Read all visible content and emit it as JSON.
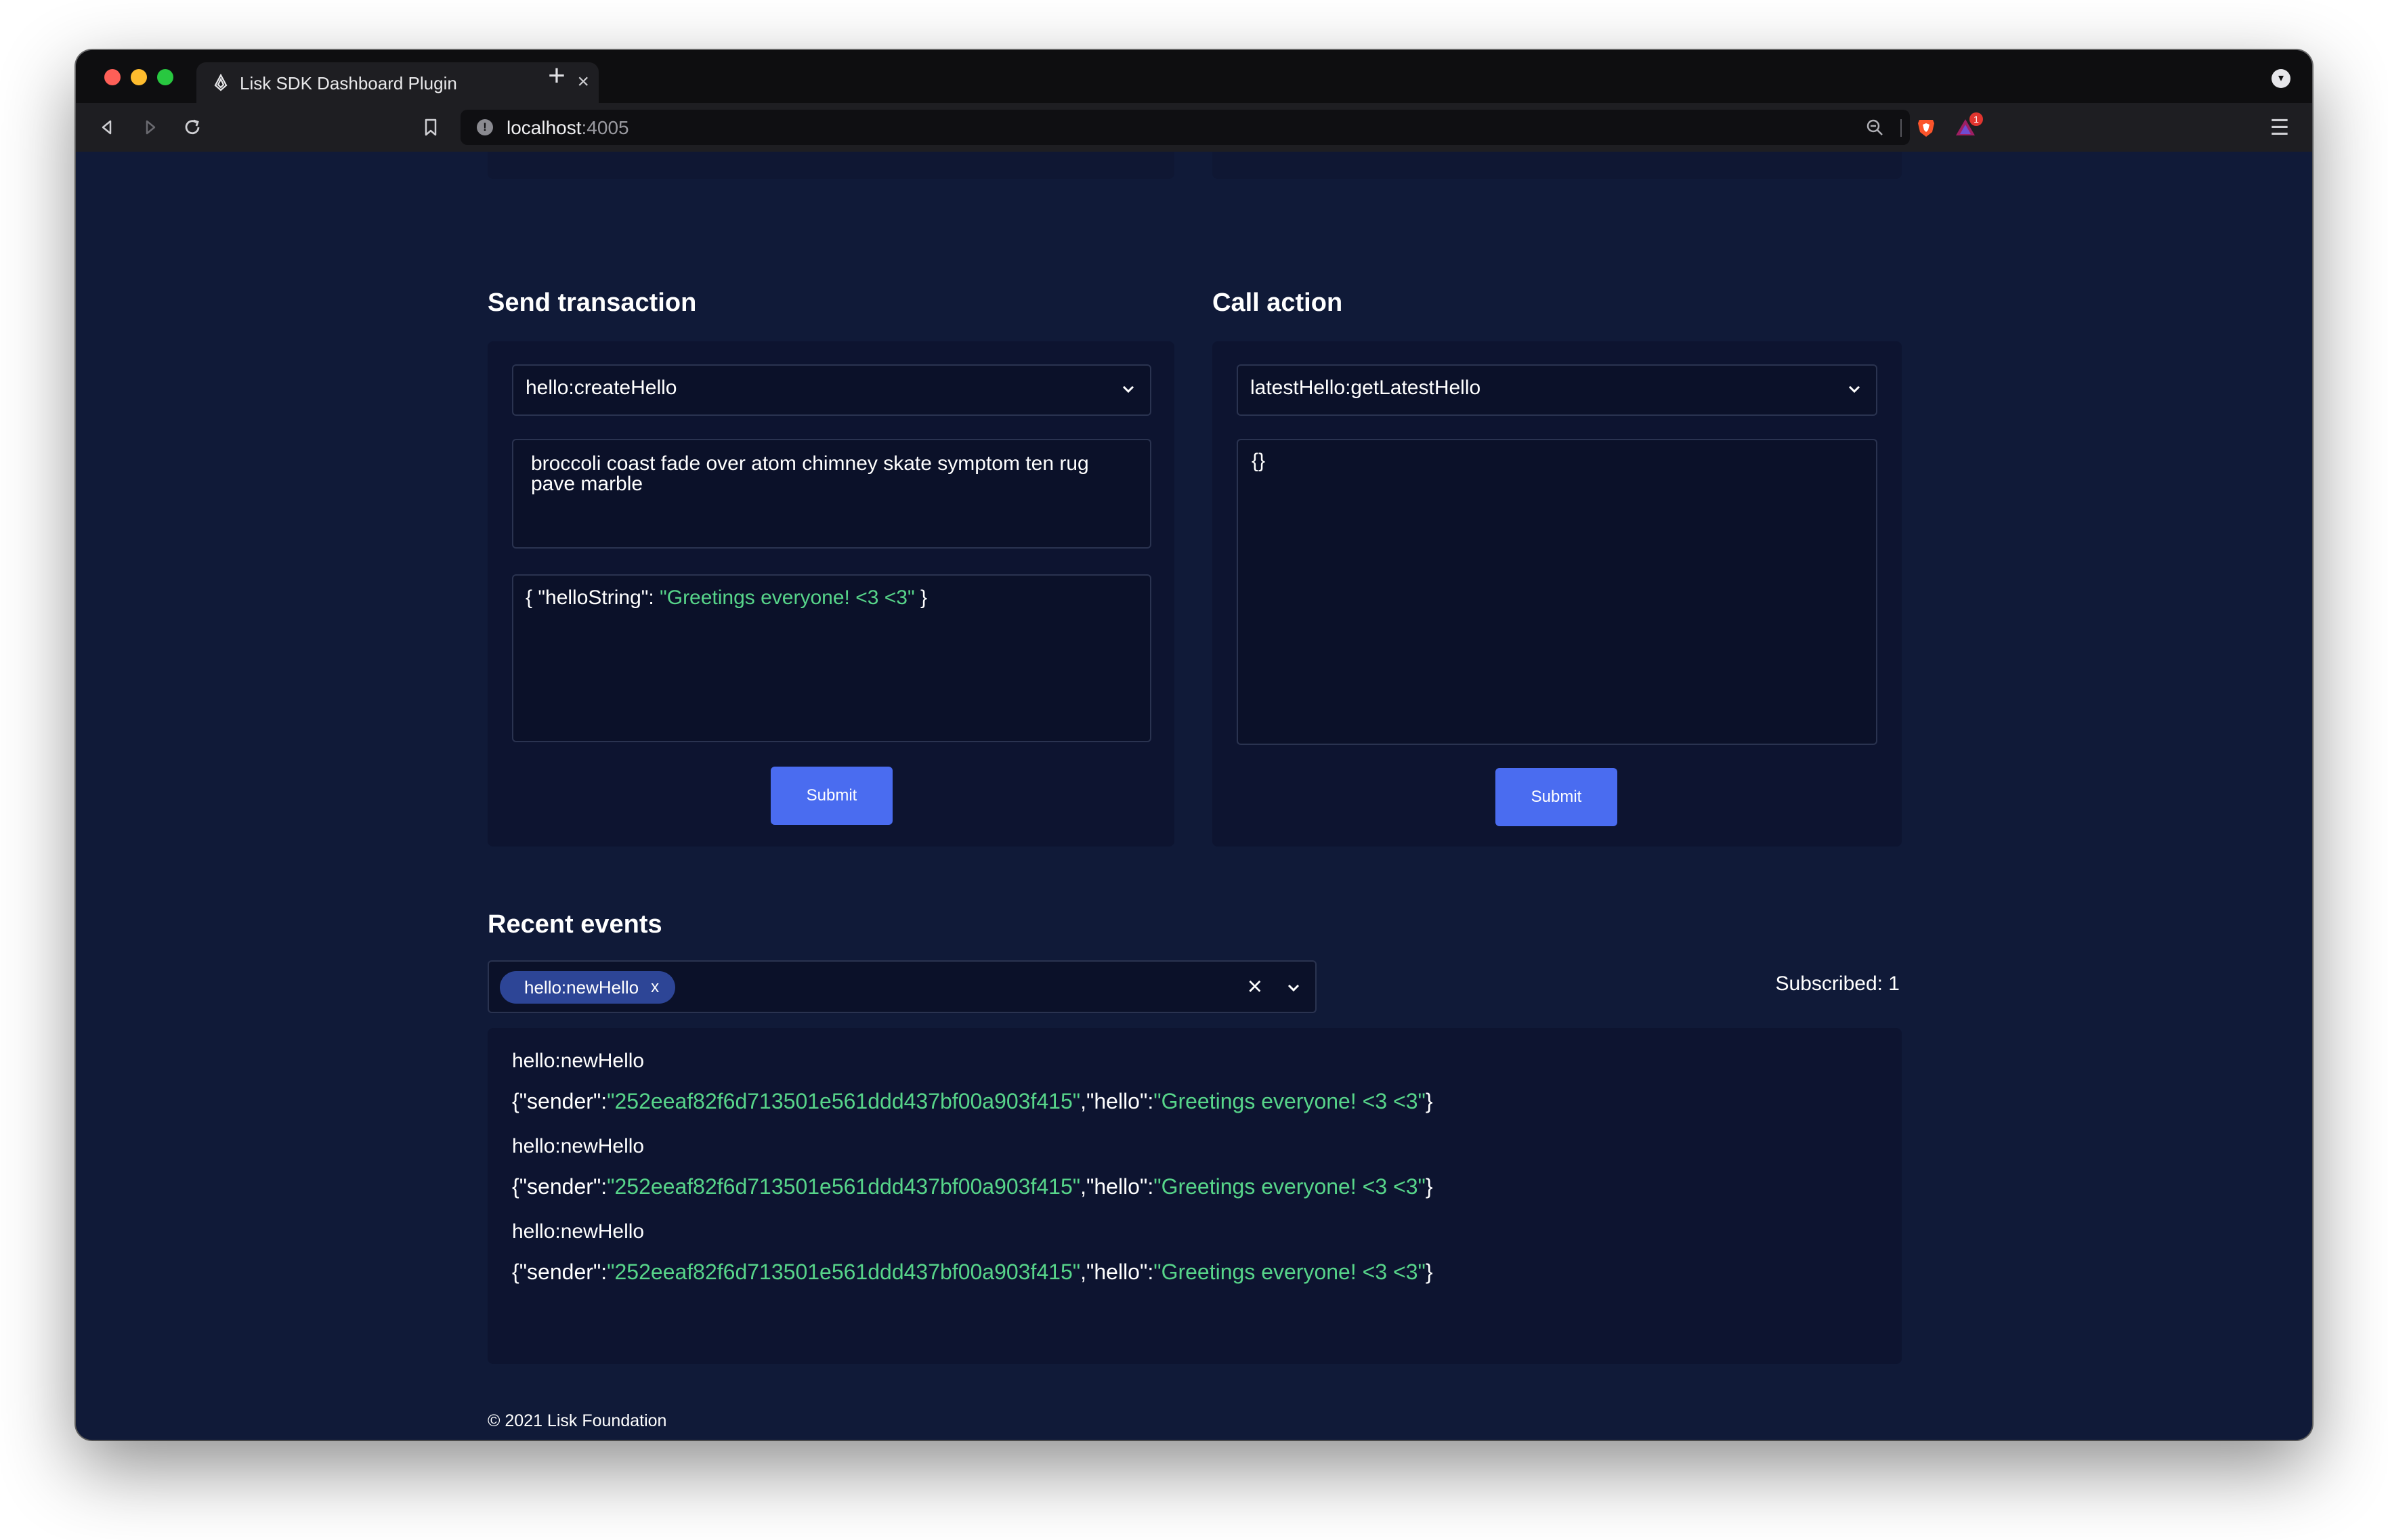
{
  "browser": {
    "tab_title": "Lisk SDK Dashboard Plugin",
    "tab_close": "×",
    "new_tab": "+",
    "url_host": "localhost",
    "url_port": ":4005",
    "rewards_badge": "1"
  },
  "send_transaction": {
    "title": "Send transaction",
    "selected_command": "hello:createHello",
    "passphrase": "broccoli coast fade over atom chimney skate symptom ten rug pave marble",
    "params_prefix": "{ \"helloString\": ",
    "params_value": "\"Greetings everyone! <3 <3\"",
    "params_suffix": " }",
    "submit_label": "Submit"
  },
  "call_action": {
    "title": "Call action",
    "selected_action": "latestHello:getLatestHello",
    "params": "{}",
    "submit_label": "Submit"
  },
  "recent_events": {
    "title": "Recent events",
    "selected_events": [
      {
        "label": "hello:newHello",
        "remove": "x"
      }
    ],
    "clear_label": "×",
    "subscribed_label": "Subscribed: 1",
    "events": [
      {
        "name": "hello:newHello",
        "open": "{\"sender\":",
        "sender": "\"252eeaf82f6d713501e561ddd437bf00a903f415\"",
        "mid": ",\"hello\":",
        "hello": "\"Greetings everyone! <3 <3\"",
        "close": "}"
      },
      {
        "name": "hello:newHello",
        "open": "{\"sender\":",
        "sender": "\"252eeaf82f6d713501e561ddd437bf00a903f415\"",
        "mid": ",\"hello\":",
        "hello": "\"Greetings everyone! <3 <3\"",
        "close": "}"
      },
      {
        "name": "hello:newHello",
        "open": "{\"sender\":",
        "sender": "\"252eeaf82f6d713501e561ddd437bf00a903f415\"",
        "mid": ",\"hello\":",
        "hello": "\"Greetings everyone! <3 <3\"",
        "close": "}"
      }
    ]
  },
  "footer": {
    "copyright": "© 2021 Lisk Foundation"
  },
  "colors": {
    "page_bg": "#101a38",
    "card_bg": "#0d1430",
    "accent_button": "#4a6cf0",
    "json_string": "#57d58a",
    "chip_bg": "#2d4596"
  }
}
